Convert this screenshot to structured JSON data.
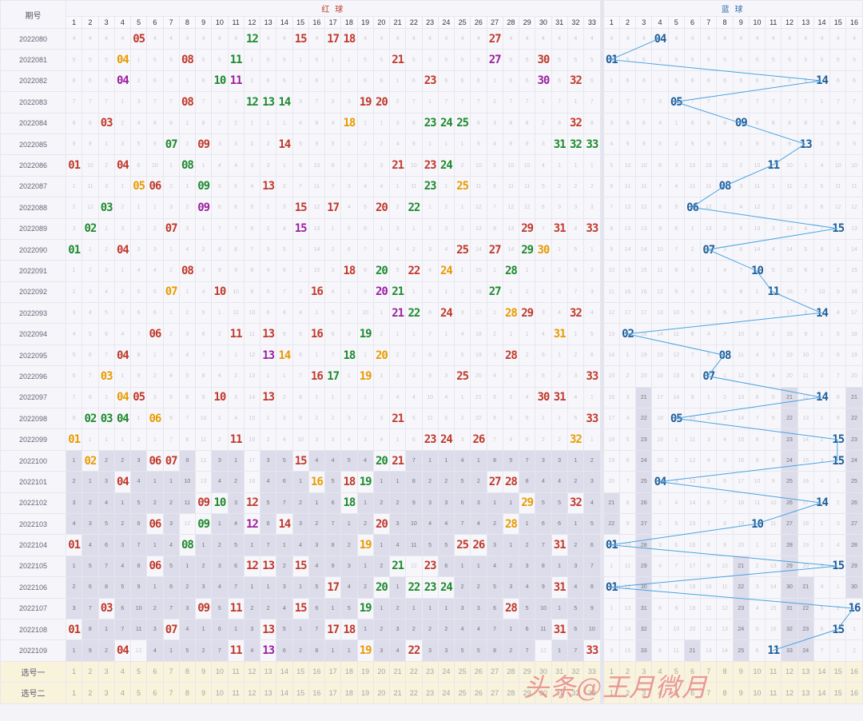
{
  "header": {
    "issue_col_label": "期号",
    "red_label": "红 球",
    "blue_label": "蓝 球"
  },
  "red_cols": [
    1,
    2,
    3,
    4,
    5,
    6,
    7,
    8,
    9,
    10,
    11,
    12,
    13,
    14,
    15,
    16,
    17,
    18,
    19,
    20,
    21,
    22,
    23,
    24,
    25,
    26,
    27,
    28,
    29,
    30,
    31,
    32,
    33
  ],
  "blue_cols": [
    1,
    2,
    3,
    4,
    5,
    6,
    7,
    8,
    9,
    10,
    11,
    12,
    13,
    14,
    15,
    16
  ],
  "colors": {
    "red": "#c0392b",
    "green": "#1e8a2e",
    "orange": "#e89b00",
    "purple": "#9b1fa0",
    "blue": "#1f5e99",
    "line": "#4aa3df"
  },
  "draws": [
    {
      "issue": "2022080",
      "red": [
        {
          "n": 5,
          "c": "red"
        },
        {
          "n": 12,
          "c": "green"
        },
        {
          "n": 15,
          "c": "red"
        },
        {
          "n": 17,
          "c": "red"
        },
        {
          "n": 18,
          "c": "red"
        },
        {
          "n": 27,
          "c": "red"
        }
      ],
      "blue": 4
    },
    {
      "issue": "2022081",
      "red": [
        {
          "n": 4,
          "c": "orange"
        },
        {
          "n": 8,
          "c": "red"
        },
        {
          "n": 11,
          "c": "green"
        },
        {
          "n": 21,
          "c": "red"
        },
        {
          "n": 27,
          "c": "purple"
        },
        {
          "n": 30,
          "c": "red"
        }
      ],
      "blue": 1
    },
    {
      "issue": "2022082",
      "red": [
        {
          "n": 4,
          "c": "purple"
        },
        {
          "n": 10,
          "c": "green"
        },
        {
          "n": 11,
          "c": "purple"
        },
        {
          "n": 23,
          "c": "red"
        },
        {
          "n": 30,
          "c": "purple"
        },
        {
          "n": 32,
          "c": "red"
        }
      ],
      "blue": 14
    },
    {
      "issue": "2022083",
      "red": [
        {
          "n": 8,
          "c": "red"
        },
        {
          "n": 12,
          "c": "green"
        },
        {
          "n": 13,
          "c": "green"
        },
        {
          "n": 14,
          "c": "green"
        },
        {
          "n": 19,
          "c": "red"
        },
        {
          "n": 20,
          "c": "red"
        }
      ],
      "blue": 5
    },
    {
      "issue": "2022084",
      "red": [
        {
          "n": 3,
          "c": "red"
        },
        {
          "n": 18,
          "c": "orange"
        },
        {
          "n": 23,
          "c": "green"
        },
        {
          "n": 24,
          "c": "green"
        },
        {
          "n": 25,
          "c": "green"
        },
        {
          "n": 32,
          "c": "red"
        }
      ],
      "blue": 9
    },
    {
      "issue": "2022085",
      "red": [
        {
          "n": 7,
          "c": "green"
        },
        {
          "n": 9,
          "c": "red"
        },
        {
          "n": 14,
          "c": "red"
        },
        {
          "n": 31,
          "c": "green"
        },
        {
          "n": 32,
          "c": "green"
        },
        {
          "n": 33,
          "c": "green"
        }
      ],
      "blue": 13
    },
    {
      "issue": "2022086",
      "red": [
        {
          "n": 1,
          "c": "red"
        },
        {
          "n": 4,
          "c": "red"
        },
        {
          "n": 8,
          "c": "green"
        },
        {
          "n": 21,
          "c": "red"
        },
        {
          "n": 23,
          "c": "red"
        },
        {
          "n": 24,
          "c": "green"
        }
      ],
      "blue": 11
    },
    {
      "issue": "2022087",
      "red": [
        {
          "n": 5,
          "c": "orange"
        },
        {
          "n": 6,
          "c": "red"
        },
        {
          "n": 9,
          "c": "green"
        },
        {
          "n": 13,
          "c": "red"
        },
        {
          "n": 23,
          "c": "green"
        },
        {
          "n": 25,
          "c": "orange"
        }
      ],
      "blue": 8
    },
    {
      "issue": "2022088",
      "red": [
        {
          "n": 3,
          "c": "green"
        },
        {
          "n": 9,
          "c": "purple"
        },
        {
          "n": 15,
          "c": "red"
        },
        {
          "n": 17,
          "c": "red"
        },
        {
          "n": 20,
          "c": "red"
        },
        {
          "n": 22,
          "c": "green"
        }
      ],
      "blue": 6
    },
    {
      "issue": "2022089",
      "red": [
        {
          "n": 2,
          "c": "green"
        },
        {
          "n": 7,
          "c": "red"
        },
        {
          "n": 15,
          "c": "purple"
        },
        {
          "n": 29,
          "c": "red"
        },
        {
          "n": 31,
          "c": "red"
        },
        {
          "n": 33,
          "c": "red"
        }
      ],
      "blue": 15
    },
    {
      "issue": "2022090",
      "red": [
        {
          "n": 1,
          "c": "green"
        },
        {
          "n": 4,
          "c": "red"
        },
        {
          "n": 25,
          "c": "red"
        },
        {
          "n": 27,
          "c": "red"
        },
        {
          "n": 29,
          "c": "green"
        },
        {
          "n": 30,
          "c": "orange"
        }
      ],
      "blue": 7
    },
    {
      "issue": "2022091",
      "red": [
        {
          "n": 8,
          "c": "red"
        },
        {
          "n": 18,
          "c": "red"
        },
        {
          "n": 20,
          "c": "green"
        },
        {
          "n": 22,
          "c": "red"
        },
        {
          "n": 24,
          "c": "orange"
        },
        {
          "n": 28,
          "c": "green"
        }
      ],
      "blue": 10
    },
    {
      "issue": "2022092",
      "red": [
        {
          "n": 7,
          "c": "orange"
        },
        {
          "n": 10,
          "c": "red"
        },
        {
          "n": 16,
          "c": "red"
        },
        {
          "n": 20,
          "c": "purple"
        },
        {
          "n": 21,
          "c": "green"
        },
        {
          "n": 27,
          "c": "green"
        }
      ],
      "blue": 11
    },
    {
      "issue": "2022093",
      "red": [
        {
          "n": 21,
          "c": "purple"
        },
        {
          "n": 22,
          "c": "green"
        },
        {
          "n": 24,
          "c": "red"
        },
        {
          "n": 28,
          "c": "orange"
        },
        {
          "n": 29,
          "c": "red"
        },
        {
          "n": 32,
          "c": "red"
        }
      ],
      "blue": 14
    },
    {
      "issue": "2022094",
      "red": [
        {
          "n": 6,
          "c": "red"
        },
        {
          "n": 11,
          "c": "red"
        },
        {
          "n": 13,
          "c": "red"
        },
        {
          "n": 16,
          "c": "red"
        },
        {
          "n": 19,
          "c": "green"
        },
        {
          "n": 31,
          "c": "orange"
        }
      ],
      "blue": 2
    },
    {
      "issue": "2022095",
      "red": [
        {
          "n": 4,
          "c": "red"
        },
        {
          "n": 13,
          "c": "purple"
        },
        {
          "n": 14,
          "c": "orange"
        },
        {
          "n": 18,
          "c": "green"
        },
        {
          "n": 20,
          "c": "orange"
        },
        {
          "n": 28,
          "c": "red"
        }
      ],
      "blue": 8
    },
    {
      "issue": "2022096",
      "red": [
        {
          "n": 3,
          "c": "orange"
        },
        {
          "n": 16,
          "c": "red"
        },
        {
          "n": 17,
          "c": "green"
        },
        {
          "n": 19,
          "c": "orange"
        },
        {
          "n": 25,
          "c": "red"
        },
        {
          "n": 33,
          "c": "red"
        }
      ],
      "blue": 7
    },
    {
      "issue": "2022097",
      "red": [
        {
          "n": 4,
          "c": "orange"
        },
        {
          "n": 5,
          "c": "red"
        },
        {
          "n": 10,
          "c": "red"
        },
        {
          "n": 13,
          "c": "red"
        },
        {
          "n": 30,
          "c": "red"
        },
        {
          "n": 31,
          "c": "red"
        }
      ],
      "blue": 14
    },
    {
      "issue": "2022098",
      "red": [
        {
          "n": 2,
          "c": "green"
        },
        {
          "n": 3,
          "c": "green"
        },
        {
          "n": 4,
          "c": "green"
        },
        {
          "n": 6,
          "c": "orange"
        },
        {
          "n": 21,
          "c": "red"
        },
        {
          "n": 33,
          "c": "red"
        }
      ],
      "blue": 5
    },
    {
      "issue": "2022099",
      "red": [
        {
          "n": 1,
          "c": "orange"
        },
        {
          "n": 11,
          "c": "red"
        },
        {
          "n": 23,
          "c": "red"
        },
        {
          "n": 24,
          "c": "red"
        },
        {
          "n": 26,
          "c": "red"
        },
        {
          "n": 32,
          "c": "orange"
        }
      ],
      "blue": 15
    },
    {
      "issue": "2022100",
      "red": [
        {
          "n": 2,
          "c": "orange"
        },
        {
          "n": 6,
          "c": "red"
        },
        {
          "n": 7,
          "c": "red"
        },
        {
          "n": 15,
          "c": "red"
        },
        {
          "n": 20,
          "c": "green"
        },
        {
          "n": 21,
          "c": "red"
        }
      ],
      "blue": 15
    },
    {
      "issue": "2022101",
      "red": [
        {
          "n": 4,
          "c": "red"
        },
        {
          "n": 16,
          "c": "orange"
        },
        {
          "n": 18,
          "c": "red"
        },
        {
          "n": 19,
          "c": "green"
        },
        {
          "n": 27,
          "c": "red"
        },
        {
          "n": 28,
          "c": "red"
        }
      ],
      "blue": 4
    },
    {
      "issue": "2022102",
      "red": [
        {
          "n": 9,
          "c": "red"
        },
        {
          "n": 10,
          "c": "green"
        },
        {
          "n": 12,
          "c": "red"
        },
        {
          "n": 18,
          "c": "green"
        },
        {
          "n": 29,
          "c": "orange"
        },
        {
          "n": 32,
          "c": "red"
        }
      ],
      "blue": 14
    },
    {
      "issue": "2022103",
      "red": [
        {
          "n": 6,
          "c": "red"
        },
        {
          "n": 9,
          "c": "green"
        },
        {
          "n": 12,
          "c": "purple"
        },
        {
          "n": 14,
          "c": "red"
        },
        {
          "n": 20,
          "c": "red"
        },
        {
          "n": 28,
          "c": "orange"
        }
      ],
      "blue": 10
    },
    {
      "issue": "2022104",
      "red": [
        {
          "n": 1,
          "c": "red"
        },
        {
          "n": 8,
          "c": "green"
        },
        {
          "n": 19,
          "c": "orange"
        },
        {
          "n": 25,
          "c": "red"
        },
        {
          "n": 26,
          "c": "red"
        },
        {
          "n": 31,
          "c": "red"
        }
      ],
      "blue": 1
    },
    {
      "issue": "2022105",
      "red": [
        {
          "n": 6,
          "c": "red"
        },
        {
          "n": 12,
          "c": "red"
        },
        {
          "n": 13,
          "c": "red"
        },
        {
          "n": 15,
          "c": "red"
        },
        {
          "n": 21,
          "c": "green"
        },
        {
          "n": 23,
          "c": "red"
        }
      ],
      "blue": 15
    },
    {
      "issue": "2022106",
      "red": [
        {
          "n": 17,
          "c": "red"
        },
        {
          "n": 20,
          "c": "green"
        },
        {
          "n": 22,
          "c": "green"
        },
        {
          "n": 23,
          "c": "green"
        },
        {
          "n": 24,
          "c": "green"
        },
        {
          "n": 31,
          "c": "red"
        }
      ],
      "blue": 1
    },
    {
      "issue": "2022107",
      "red": [
        {
          "n": 3,
          "c": "red"
        },
        {
          "n": 9,
          "c": "red"
        },
        {
          "n": 11,
          "c": "red"
        },
        {
          "n": 15,
          "c": "red"
        },
        {
          "n": 19,
          "c": "green"
        },
        {
          "n": 28,
          "c": "red"
        }
      ],
      "blue": 16
    },
    {
      "issue": "2022108",
      "red": [
        {
          "n": 1,
          "c": "red"
        },
        {
          "n": 7,
          "c": "red"
        },
        {
          "n": 13,
          "c": "red"
        },
        {
          "n": 17,
          "c": "red"
        },
        {
          "n": 18,
          "c": "red"
        },
        {
          "n": 31,
          "c": "red"
        }
      ],
      "blue": 15
    },
    {
      "issue": "2022109",
      "red": [
        {
          "n": 4,
          "c": "red"
        },
        {
          "n": 11,
          "c": "red"
        },
        {
          "n": 13,
          "c": "purple"
        },
        {
          "n": 19,
          "c": "orange"
        },
        {
          "n": 22,
          "c": "red"
        },
        {
          "n": 33,
          "c": "red"
        }
      ],
      "blue": 11
    }
  ],
  "pick_rows": [
    {
      "label": "选号一"
    },
    {
      "label": "选号二"
    }
  ],
  "watermark": "头条@王月微月"
}
